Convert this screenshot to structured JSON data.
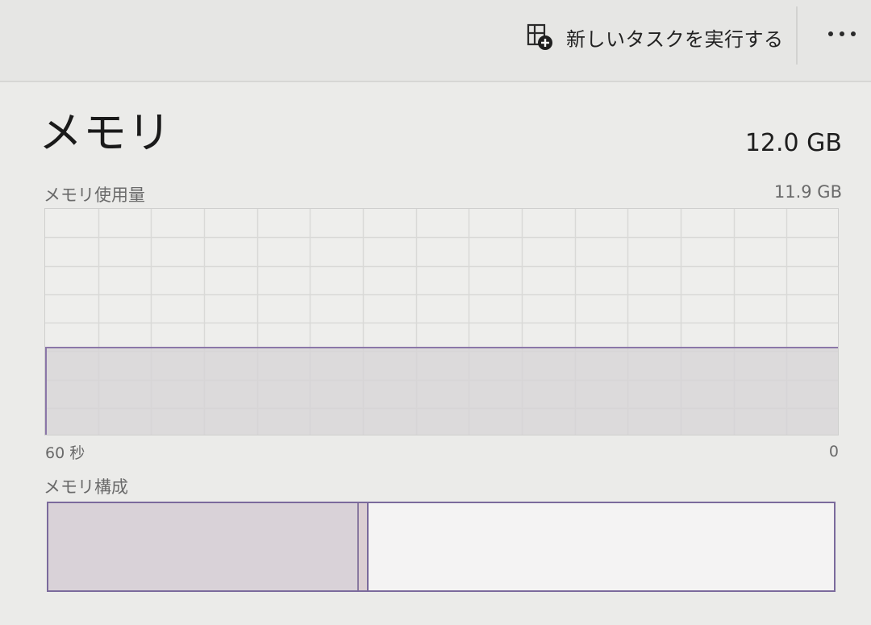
{
  "toolbar": {
    "run_task_label": "新しいタスクを実行する",
    "run_task_icon": "run-new-task-icon",
    "more_label": "…",
    "more_icon": "more-options-icon"
  },
  "memory": {
    "title": "メモリ",
    "total": "12.0 GB",
    "usage_label": "メモリ使用量",
    "usage_max": "11.9 GB",
    "axis_left": "60 秒",
    "axis_right": "0",
    "composition_label": "メモリ構成",
    "usage_fraction": 0.39,
    "composition_in_use_fraction": 0.395,
    "composition_modified_fraction": 0.013
  },
  "colors": {
    "accent": "#8b77a8",
    "fill": "#d5d3d6",
    "grid": "#d9d9d7",
    "background": "#ebebe9"
  }
}
